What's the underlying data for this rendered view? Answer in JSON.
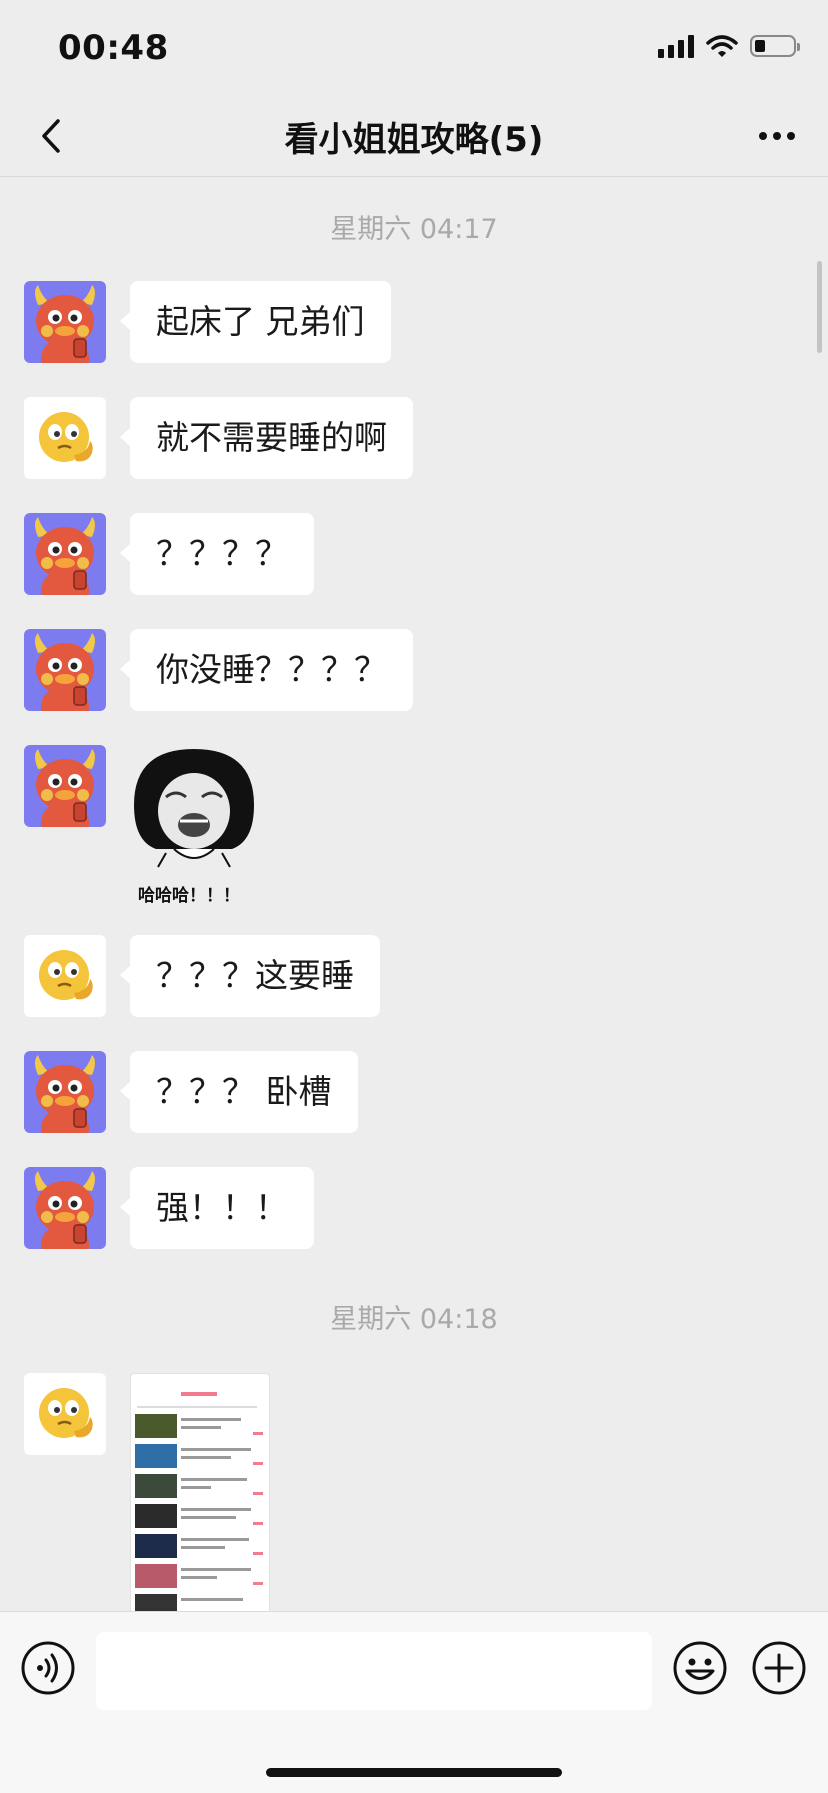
{
  "status_bar": {
    "time": "00:48",
    "icons": [
      "cellular-signal-icon",
      "wifi-icon",
      "battery-icon"
    ]
  },
  "header": {
    "title": "看小姐姐攻略(5)",
    "back_icon": "chevron-left-icon",
    "more_icon": "more-dots-icon"
  },
  "chat": {
    "timestamps": [
      "星期六 04:17",
      "星期六 04:18"
    ],
    "messages": [
      {
        "sender": "devil",
        "text": "起床了  兄弟们"
      },
      {
        "sender": "emoji",
        "text": "就不需要睡的啊"
      },
      {
        "sender": "devil",
        "text": "？？？？"
      },
      {
        "sender": "devil",
        "text": "你没睡？？？？"
      },
      {
        "sender": "devil",
        "sticker_caption": "哈哈哈！！！"
      },
      {
        "sender": "emoji",
        "text": "？？？这要睡"
      },
      {
        "sender": "devil",
        "text": "？？？ 卧槽"
      },
      {
        "sender": "devil",
        "text": "强！！！"
      },
      {
        "sender": "emoji",
        "image": "screenshot-thumbnail"
      }
    ]
  },
  "input_bar": {
    "voice_icon": "voice-icon",
    "text_value": "",
    "emoji_icon": "emoji-icon",
    "plus_icon": "plus-icon"
  },
  "colors": {
    "background": "#ededed",
    "bubble": "#ffffff",
    "timestamp": "#a9a9a9",
    "devil_avatar_bg": "#7d7bf0",
    "devil_face": "#e2593f"
  }
}
